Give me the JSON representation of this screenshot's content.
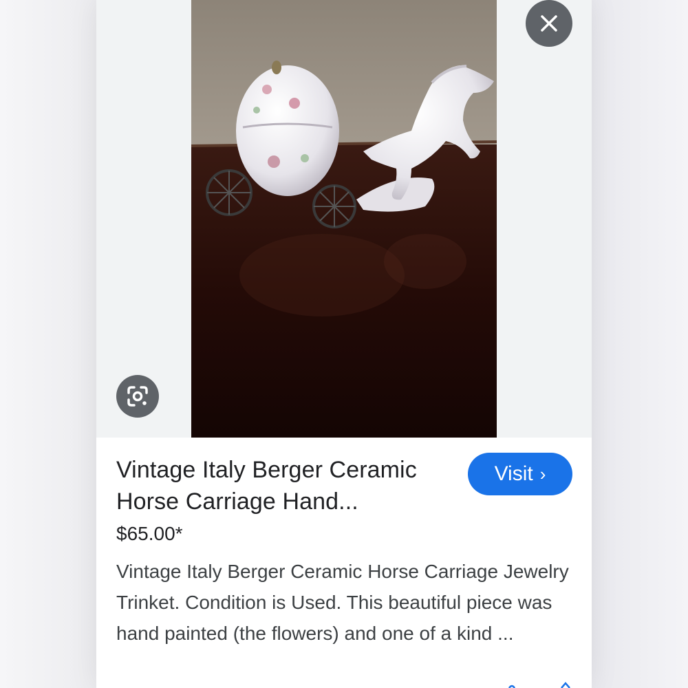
{
  "result": {
    "title": "Vintage Italy Berger Ceramic Horse Carriage Hand...",
    "price": "$65.00*",
    "description": "Vintage Italy Berger Ceramic Horse Carriage Jewelry Trinket. Condition is Used. This beautiful piece was hand painted (the flowers) and one of a kind ...",
    "visit_label": "Visit",
    "visit_chevron": "›"
  },
  "icons": {
    "close": "close-icon",
    "lens": "google-lens-icon",
    "visit": "chevron-right-icon"
  },
  "colors": {
    "accent": "#1a73e8",
    "overlay_button": "#5f6368",
    "title_text": "#202124",
    "body_text": "#3c4043"
  }
}
